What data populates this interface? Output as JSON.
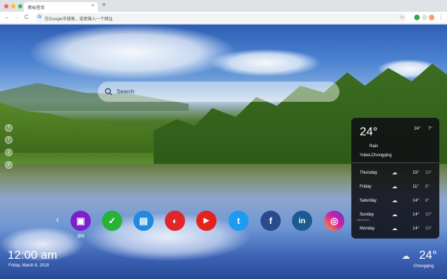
{
  "browser": {
    "tab_title": "新标签页",
    "tab_close": "×",
    "new_tab": "+",
    "back": "←",
    "forward": "→",
    "reload": "C",
    "omnibox_placeholder": "在Google中搜索，或者输入一个网址",
    "google_glyph": "G",
    "star": "☆",
    "menu": "⋮",
    "traffic_colors": [
      "#ff5f57",
      "#febc2e",
      "#28c840"
    ],
    "ext_colors": [
      "#34a853",
      "#e0e0e0",
      "#f4a261"
    ]
  },
  "search": {
    "placeholder": "Search"
  },
  "side_social": [
    {
      "icon": "facebook-icon",
      "glyph": "f"
    },
    {
      "icon": "twitter-icon",
      "glyph": "t"
    },
    {
      "icon": "google-icon",
      "glyph": "g"
    },
    {
      "icon": "pinterest-icon",
      "glyph": "p"
    }
  ],
  "apps": {
    "prev": "‹",
    "next": "›",
    "items": [
      {
        "name": "gallery",
        "color": "#7b1fd1",
        "glyph": "▣",
        "label": "图库"
      },
      {
        "name": "tasks",
        "color": "#27b338",
        "glyph": "✓"
      },
      {
        "name": "notes",
        "color": "#1f8be0",
        "glyph": "▤"
      },
      {
        "name": "games",
        "color": "#e0262a",
        "glyph": "◐"
      },
      {
        "name": "youtube",
        "color": "#e5221b",
        "glyph": "▶"
      },
      {
        "name": "twitter",
        "color": "#1d9bf0",
        "glyph": "t"
      },
      {
        "name": "facebook",
        "color": "#2b4a8c",
        "glyph": "f"
      },
      {
        "name": "linkedin",
        "color": "#1b5b8f",
        "glyph": "in"
      },
      {
        "name": "instagram",
        "color": "#d6249f",
        "glyph": "◎"
      }
    ]
  },
  "weather": {
    "temp": "24°",
    "high": "24°",
    "low": "7°",
    "condition": "Rain",
    "location": "Yubei,Chongqing",
    "source": "amazon",
    "forecast": [
      {
        "day": "Thursday",
        "hi": "15°",
        "lo": "10°"
      },
      {
        "day": "Friday",
        "hi": "11°",
        "lo": "8°"
      },
      {
        "day": "Saturday",
        "hi": "14°",
        "lo": "8°"
      },
      {
        "day": "Sunday",
        "hi": "14°",
        "lo": "10°"
      },
      {
        "day": "Monday",
        "hi": "14°",
        "lo": "10°"
      }
    ]
  },
  "clock": {
    "time": "12:00 am",
    "date": "Friday, March 8, 2019"
  },
  "bottom_weather": {
    "temp": "24°",
    "city": "Chongqing",
    "icon": "☁"
  }
}
